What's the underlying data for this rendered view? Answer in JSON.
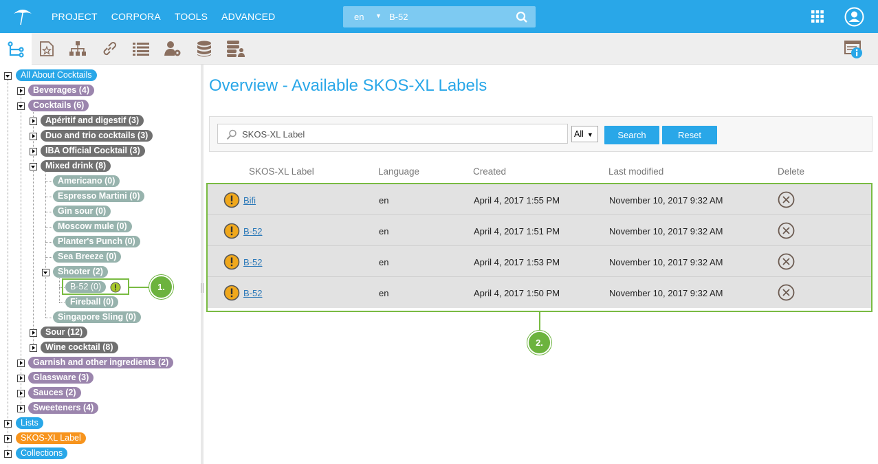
{
  "topbar": {
    "menu": [
      "PROJECT",
      "CORPORA",
      "TOOLS",
      "ADVANCED"
    ],
    "search": {
      "language": "en",
      "query": "B-52"
    }
  },
  "toolbar2": {
    "icons": [
      "hierarchy-tree-icon",
      "concept-scheme-icon",
      "org-tree-icon",
      "link-icon",
      "list-icon",
      "user-settings-icon",
      "database-icon",
      "database-user-icon"
    ]
  },
  "tree": {
    "root": "All About Cocktails",
    "beverages": "Beverages (4)",
    "cocktails": "Cocktails (6)",
    "aperitif": "Apéritif and digestif (3)",
    "duo": "Duo and trio cocktails (3)",
    "iba": "IBA Official Cocktail (3)",
    "mixed": "Mixed drink (8)",
    "americano": "Americano (0)",
    "espresso": "Espresso Martini (0)",
    "ginsour": "Gin sour (0)",
    "moscow": "Moscow mule (0)",
    "planters": "Planter's Punch (0)",
    "seabreeze": "Sea Breeze (0)",
    "shooter": "Shooter (2)",
    "b52": "B-52 (0)",
    "fireball": "Fireball (0)",
    "singapore": "Singapore Sling (0)",
    "sour": "Sour (12)",
    "wine": "Wine cocktail (8)",
    "garnish": "Garnish and other ingredients (2)",
    "glassware": "Glassware (3)",
    "sauces": "Sauces (2)",
    "sweeteners": "Sweeteners (4)",
    "lists": "Lists",
    "skosxl": "SKOS-XL Label",
    "collections": "Collections"
  },
  "main": {
    "title": "Overview - Available SKOS-XL Labels",
    "filter_placeholder": "SKOS-XL Label",
    "filter_select": "All",
    "search_btn": "Search",
    "reset_btn": "Reset",
    "columns": [
      "SKOS-XL Label",
      "Language",
      "Created",
      "Last modified",
      "Delete"
    ],
    "rows": [
      {
        "label": "Bifi",
        "lang": "en",
        "created": "April 4, 2017 1:55 PM",
        "modified": "November 10, 2017 9:32 AM"
      },
      {
        "label": "B-52",
        "lang": "en",
        "created": "April 4, 2017 1:51 PM",
        "modified": "November 10, 2017 9:32 AM"
      },
      {
        "label": "B-52",
        "lang": "en",
        "created": "April 4, 2017 1:53 PM",
        "modified": "November 10, 2017 9:32 AM"
      },
      {
        "label": "B-52",
        "lang": "en",
        "created": "April 4, 2017 1:50 PM",
        "modified": "November 10, 2017 9:32 AM"
      }
    ]
  },
  "callouts": {
    "one": "1.",
    "two": "2."
  }
}
